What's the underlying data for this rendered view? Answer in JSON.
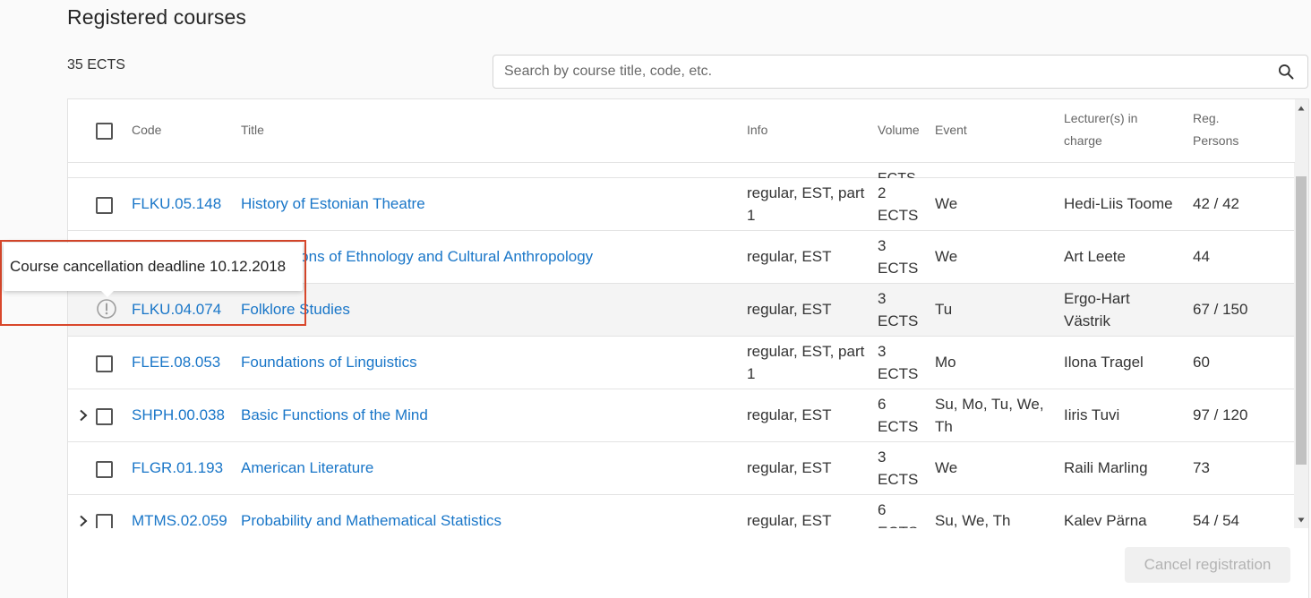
{
  "page": {
    "title": "Registered courses",
    "ects_total": "35 ECTS"
  },
  "search": {
    "placeholder": "Search by course title, code, etc.",
    "value": ""
  },
  "table": {
    "headers": {
      "code": "Code",
      "title": "Title",
      "info": "Info",
      "volume": "Volume",
      "event": "Event",
      "lecturer_line1": "Lecturer(s) in",
      "lecturer_line2": "charge",
      "reg_line1": "Reg.",
      "reg_line2": "Persons"
    },
    "clipped_row": {
      "volume_line2": "ECTS"
    },
    "rows": [
      {
        "code": "FLKU.05.148",
        "title": "History of Estonian Theatre",
        "info_line1": "regular, EST, part",
        "info_line2": "1",
        "volume_line1": "2",
        "volume_line2": "ECTS",
        "event_line1": "We",
        "event_line2": "",
        "lecturer_line1": "Hedi-Liis Toome",
        "lecturer_line2": "",
        "reg": "42 / 42"
      },
      {
        "code": "",
        "title": "Foundations of Ethnology and Cultural Anthropology",
        "info_line1": "regular, EST",
        "info_line2": "",
        "volume_line1": "3",
        "volume_line2": "ECTS",
        "event_line1": "We",
        "event_line2": "",
        "lecturer_line1": "Art Leete",
        "lecturer_line2": "",
        "reg": "44"
      },
      {
        "code": "FLKU.04.074",
        "title": "Folklore Studies",
        "info_line1": "regular, EST",
        "info_line2": "",
        "volume_line1": "3",
        "volume_line2": "ECTS",
        "event_line1": "Tu",
        "event_line2": "",
        "lecturer_line1": "Ergo-Hart",
        "lecturer_line2": "Västrik",
        "reg": "67 / 150"
      },
      {
        "code": "FLEE.08.053",
        "title": "Foundations of Linguistics",
        "info_line1": "regular, EST, part",
        "info_line2": "1",
        "volume_line1": "3",
        "volume_line2": "ECTS",
        "event_line1": "Mo",
        "event_line2": "",
        "lecturer_line1": "Ilona Tragel",
        "lecturer_line2": "",
        "reg": "60"
      },
      {
        "code": "SHPH.00.038",
        "title": "Basic Functions of the Mind",
        "info_line1": "regular, EST",
        "info_line2": "",
        "volume_line1": "6",
        "volume_line2": "ECTS",
        "event_line1": "Su, Mo, Tu, We,",
        "event_line2": "Th",
        "lecturer_line1": "Iiris Tuvi",
        "lecturer_line2": "",
        "reg": "97 / 120"
      },
      {
        "code": "FLGR.01.193",
        "title": "American Literature",
        "info_line1": "regular, EST",
        "info_line2": "",
        "volume_line1": "3",
        "volume_line2": "ECTS",
        "event_line1": "We",
        "event_line2": "",
        "lecturer_line1": "Raili Marling",
        "lecturer_line2": "",
        "reg": "73"
      },
      {
        "code": "MTMS.02.059",
        "title": "Probability and Mathematical Statistics",
        "info_line1": "regular, EST",
        "info_line2": "",
        "volume_line1": "6",
        "volume_line2": "ECTS",
        "event_line1": "Su, We, Th",
        "event_line2": "",
        "lecturer_line1": "Kalev Pärna",
        "lecturer_line2": "",
        "reg": "54 / 54"
      }
    ]
  },
  "tooltip": {
    "text": "Course cancellation deadline 10.12.2018"
  },
  "actions": {
    "cancel_label": "Cancel registration"
  },
  "colors": {
    "link": "#1976c8",
    "highlight_frame": "#d9472b",
    "disabled_text": "#b3b3b3"
  }
}
